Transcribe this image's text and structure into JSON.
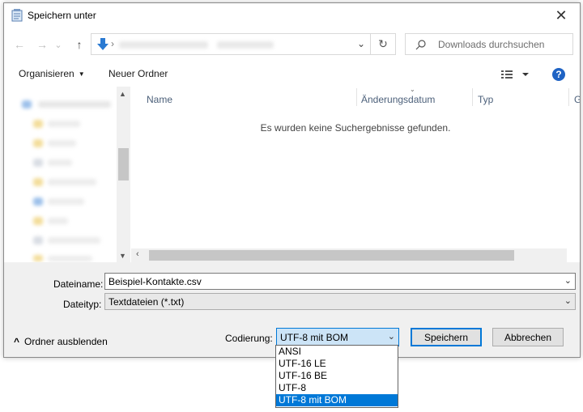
{
  "window": {
    "title": "Speichern unter",
    "close_glyph": "✕"
  },
  "nav": {
    "back_glyph": "←",
    "forward_glyph": "→",
    "history_glyph": "⌄",
    "up_glyph": "↑",
    "path_separator": "›",
    "address_dropdown_glyph": "⌄",
    "refresh_glyph": "↻",
    "search_placeholder": "Downloads durchsuchen"
  },
  "toolbar": {
    "organize_label": "Organisieren",
    "new_folder_label": "Neuer Ordner",
    "help_glyph": "?"
  },
  "file_list": {
    "columns": [
      "Name",
      "Änderungsdatum",
      "Typ",
      "G"
    ],
    "empty_message": "Es wurden keine Suchergebnisse gefunden."
  },
  "form": {
    "filename_label": "Dateiname:",
    "filename_value": "Beispiel-Kontakte.csv",
    "filetype_label": "Dateityp:",
    "filetype_value": "Textdateien (*.txt)",
    "encoding_label": "Codierung:",
    "encoding_value": "UTF-8 mit BOM",
    "encoding_options": [
      "ANSI",
      "UTF-16 LE",
      "UTF-16 BE",
      "UTF-8",
      "UTF-8 mit BOM"
    ],
    "encoding_selected_index": 4
  },
  "buttons": {
    "save_label": "Speichern",
    "cancel_label": "Abbrechen",
    "hide_folders_label": "Ordner ausblenden",
    "hide_folders_glyph": "^"
  },
  "colors": {
    "accent": "#0078d7",
    "help_blue": "#1f63c4",
    "panel_gray": "#f0f0f0"
  }
}
